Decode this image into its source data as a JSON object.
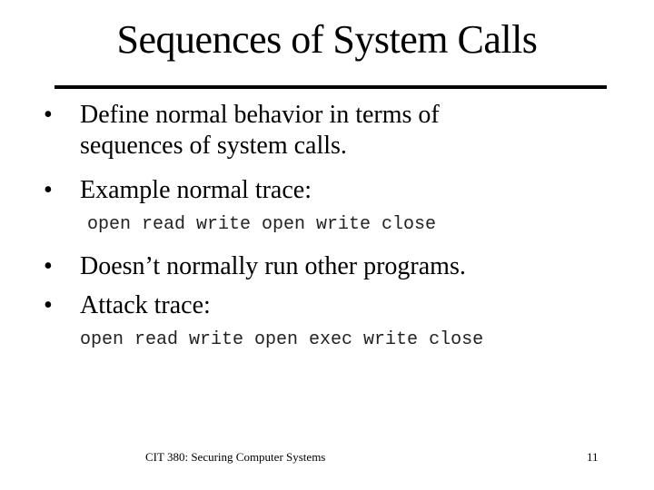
{
  "slide": {
    "title": "Sequences of System Calls",
    "bullet_glyph": "•",
    "bullets": [
      {
        "lines": [
          "Define normal behavior in terms of",
          "sequences of system calls."
        ]
      },
      {
        "lines": [
          "Example normal trace:"
        ],
        "code": "open read write open write close"
      },
      {
        "lines": [
          "Doesn’t normally run other programs."
        ]
      },
      {
        "lines": [
          "Attack trace:"
        ],
        "code": "open read write open exec write close"
      }
    ],
    "footer": {
      "course": "CIT 380: Securing Computer Systems",
      "page_number": "11"
    }
  }
}
